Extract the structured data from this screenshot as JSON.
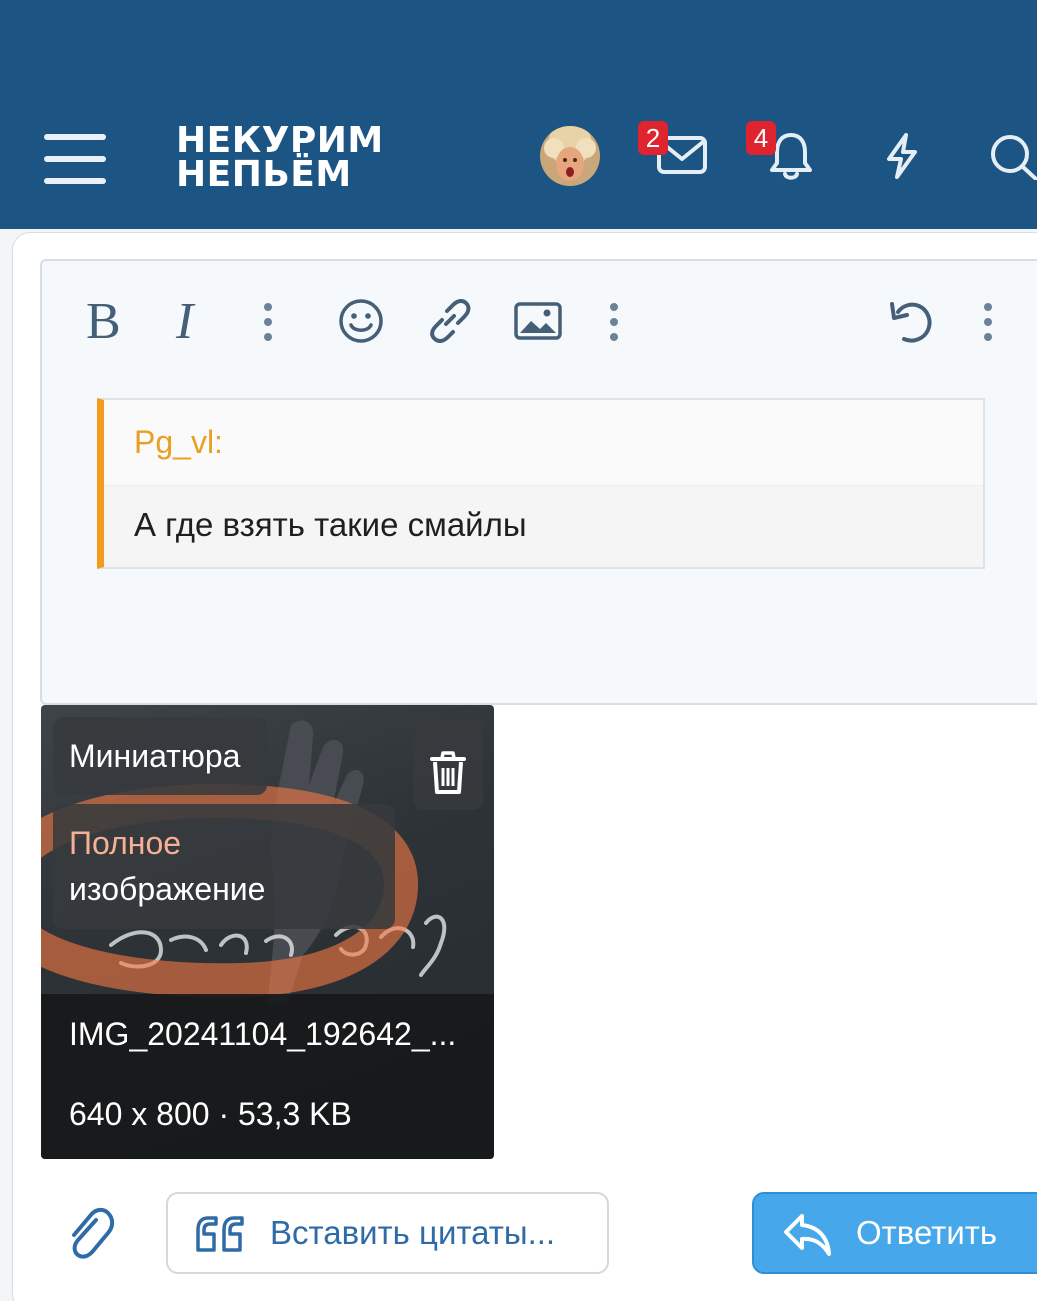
{
  "header": {
    "logo_line1": "НЕКУРИМ",
    "logo_line2": "НЕПЬЁМ",
    "messages_badge": "2",
    "alerts_badge": "4",
    "colors": {
      "background": "#1c5584",
      "badge": "#e0242f"
    }
  },
  "toolbar": {
    "bold_label": "B",
    "italic_label": "I"
  },
  "quote": {
    "author": "Pg_vl:",
    "text": "А где взять такие смайлы"
  },
  "attachment": {
    "thumbnail_label": "Миниатюра",
    "full_line1": "Полное",
    "full_line2": "изображение",
    "filename": "IMG_20241104_192642_...",
    "meta": "640 x 800 · 53,3 KB"
  },
  "actions": {
    "insert_quotes_label": "Вставить цитаты...",
    "reply_label": "Ответить",
    "colors": {
      "reply": "#47a7eb",
      "link": "#2f6ba6"
    }
  }
}
